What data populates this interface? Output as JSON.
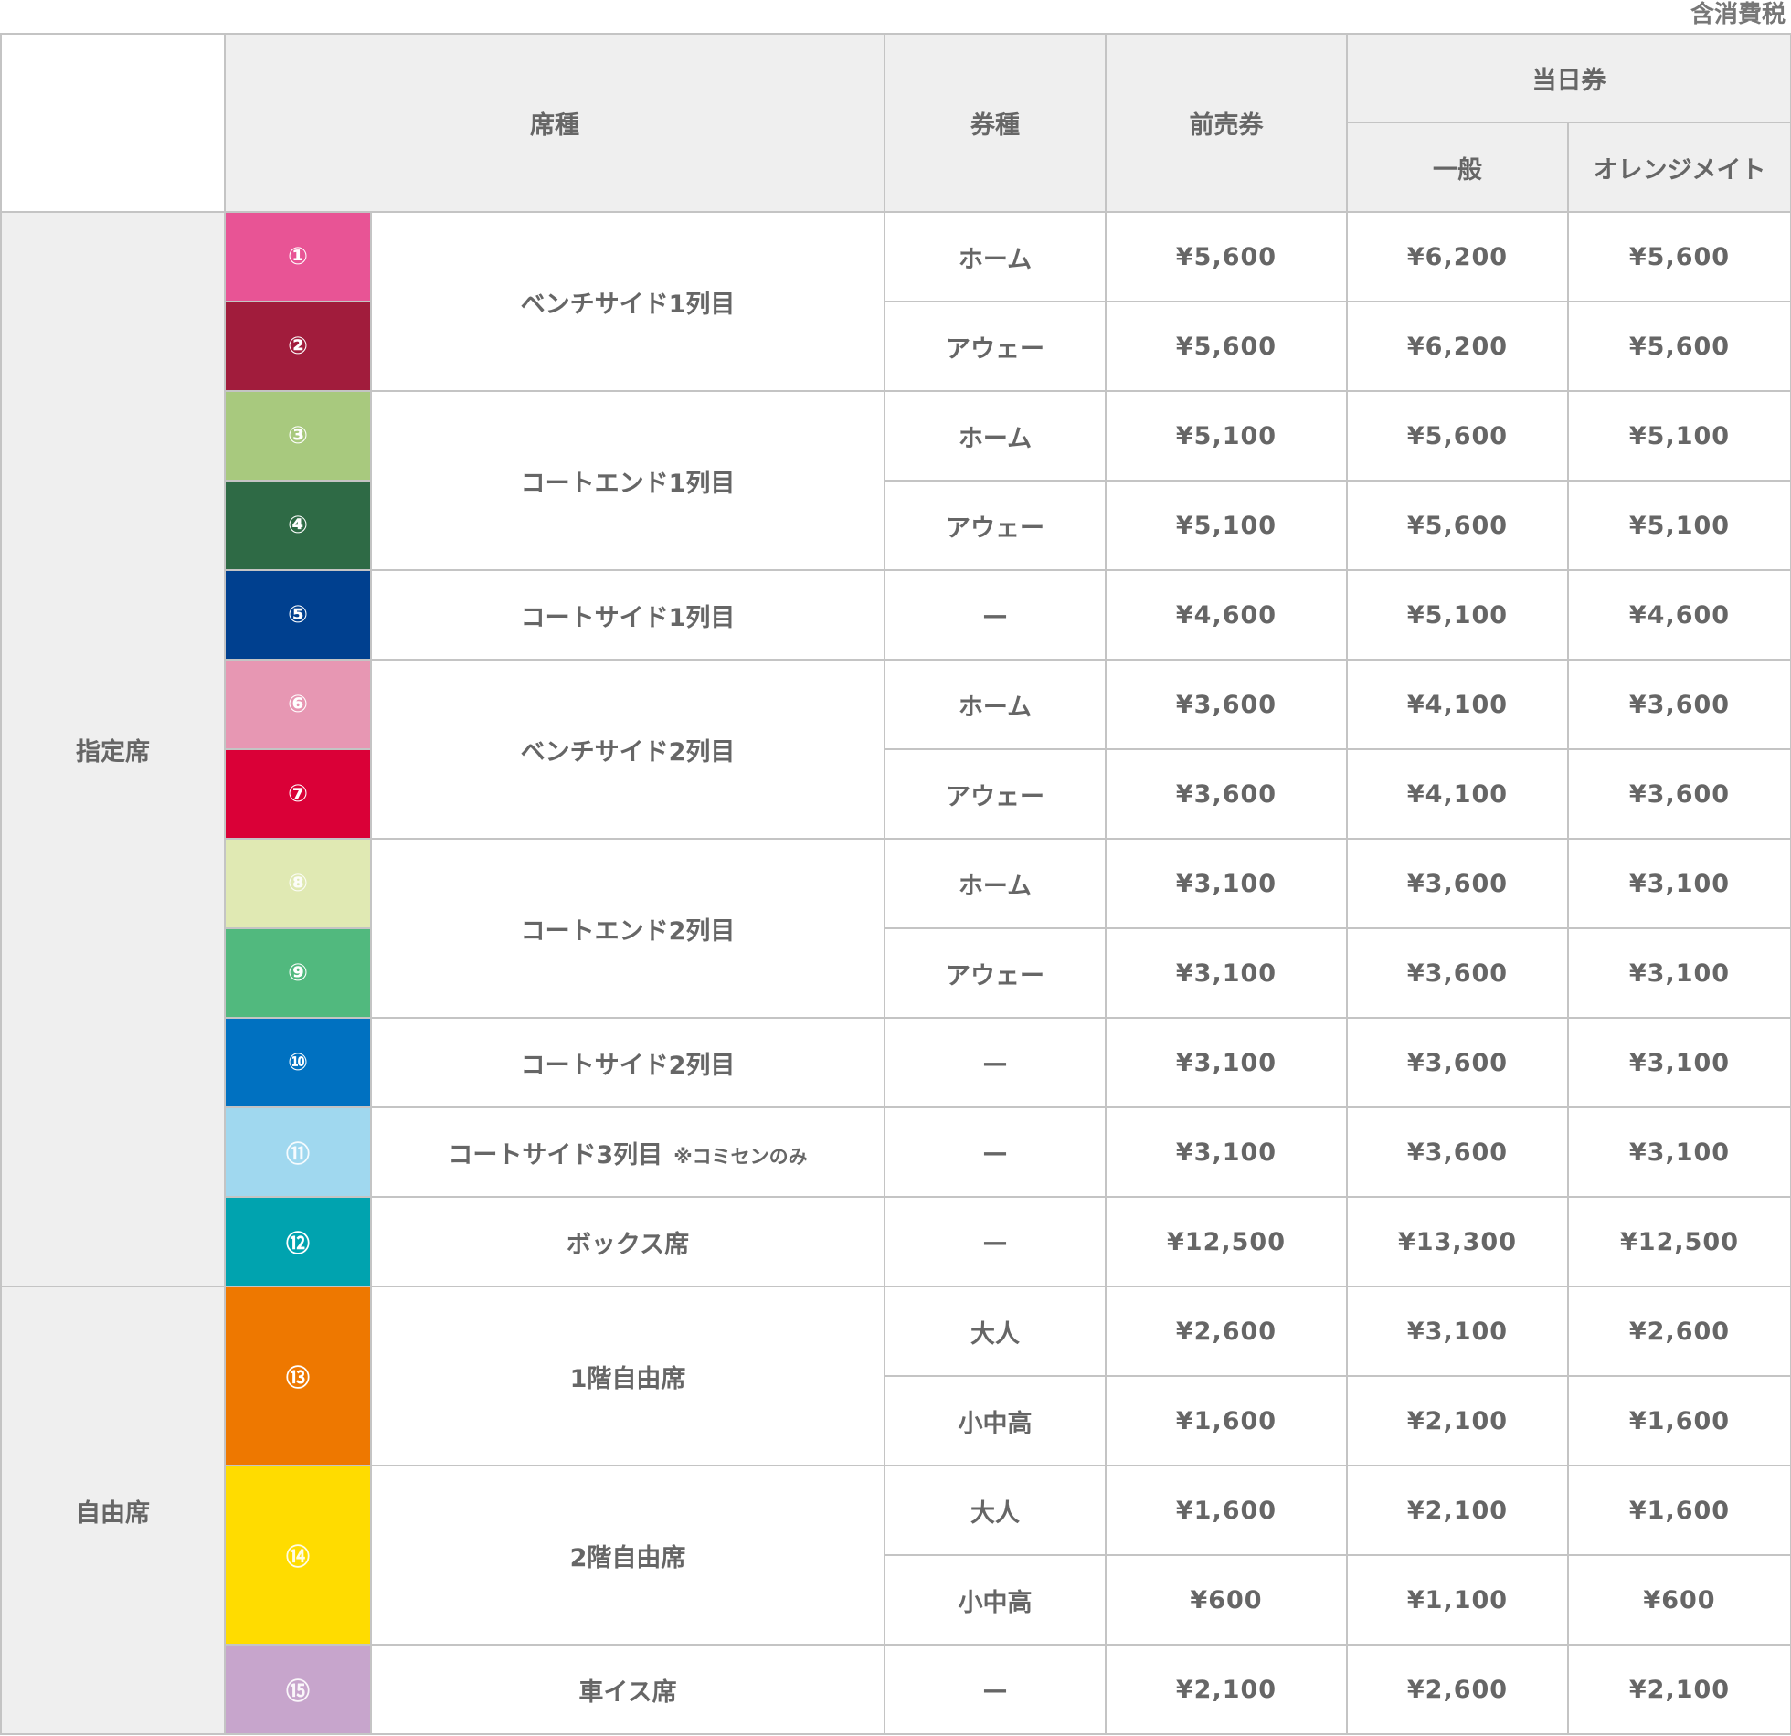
{
  "tax_note": "含消費税",
  "header": {
    "seat_type": "席種",
    "ticket_type": "券種",
    "advance": "前売券",
    "day_of": "当日券",
    "general": "一般",
    "orange_mate": "オレンジメイト"
  },
  "groups": [
    {
      "label": "指定席"
    },
    {
      "label": "自由席"
    }
  ],
  "seats": [
    {
      "num": "①",
      "color": "#e85495",
      "name": "ベンチサイド1列目",
      "note": ""
    },
    {
      "num": "②",
      "color": "#a11c3c",
      "name": "",
      "note": ""
    },
    {
      "num": "③",
      "color": "#a8c97e",
      "name": "コートエンド1列目",
      "note": ""
    },
    {
      "num": "④",
      "color": "#2e6a45",
      "name": "",
      "note": ""
    },
    {
      "num": "⑤",
      "color": "#00408f",
      "name": "コートサイド1列目",
      "note": ""
    },
    {
      "num": "⑥",
      "color": "#e797b3",
      "name": "ベンチサイド2列目",
      "note": ""
    },
    {
      "num": "⑦",
      "color": "#da0037",
      "name": "",
      "note": ""
    },
    {
      "num": "⑧",
      "color": "#e0e9b3",
      "name": "コートエンド2列目",
      "note": ""
    },
    {
      "num": "⑨",
      "color": "#51b97e",
      "name": "",
      "note": ""
    },
    {
      "num": "⑩",
      "color": "#0071c1",
      "name": "コートサイド2列目",
      "note": ""
    },
    {
      "num": "⑪",
      "color": "#a0d8ef",
      "name": "コートサイド3列目",
      "note": "※コミセンのみ"
    },
    {
      "num": "⑫",
      "color": "#00a3af",
      "name": "ボックス席",
      "note": ""
    },
    {
      "num": "⑬",
      "color": "#ee7800",
      "name": "1階自由席",
      "note": ""
    },
    {
      "num": "⑭",
      "color": "#ffdc00",
      "name": "2階自由席",
      "note": ""
    },
    {
      "num": "⑮",
      "color": "#c7a5cc",
      "name": "車イス席",
      "note": ""
    }
  ],
  "rows": [
    {
      "ticket": "ホーム",
      "advance": "¥5,600",
      "general": "¥6,200",
      "orange": "¥5,600"
    },
    {
      "ticket": "アウェー",
      "advance": "¥5,600",
      "general": "¥6,200",
      "orange": "¥5,600"
    },
    {
      "ticket": "ホーム",
      "advance": "¥5,100",
      "general": "¥5,600",
      "orange": "¥5,100"
    },
    {
      "ticket": "アウェー",
      "advance": "¥5,100",
      "general": "¥5,600",
      "orange": "¥5,100"
    },
    {
      "ticket": "—",
      "advance": "¥4,600",
      "general": "¥5,100",
      "orange": "¥4,600"
    },
    {
      "ticket": "ホーム",
      "advance": "¥3,600",
      "general": "¥4,100",
      "orange": "¥3,600"
    },
    {
      "ticket": "アウェー",
      "advance": "¥3,600",
      "general": "¥4,100",
      "orange": "¥3,600"
    },
    {
      "ticket": "ホーム",
      "advance": "¥3,100",
      "general": "¥3,600",
      "orange": "¥3,100"
    },
    {
      "ticket": "アウェー",
      "advance": "¥3,100",
      "general": "¥3,600",
      "orange": "¥3,100"
    },
    {
      "ticket": "—",
      "advance": "¥3,100",
      "general": "¥3,600",
      "orange": "¥3,100"
    },
    {
      "ticket": "—",
      "advance": "¥3,100",
      "general": "¥3,600",
      "orange": "¥3,100"
    },
    {
      "ticket": "—",
      "advance": "¥12,500",
      "general": "¥13,300",
      "orange": "¥12,500"
    },
    {
      "ticket": "大人",
      "advance": "¥2,600",
      "general": "¥3,100",
      "orange": "¥2,600"
    },
    {
      "ticket": "小中高",
      "advance": "¥1,600",
      "general": "¥2,100",
      "orange": "¥1,600"
    },
    {
      "ticket": "大人",
      "advance": "¥1,600",
      "general": "¥2,100",
      "orange": "¥1,600"
    },
    {
      "ticket": "小中高",
      "advance": "¥600",
      "general": "¥1,100",
      "orange": "¥600"
    },
    {
      "ticket": "—",
      "advance": "¥2,100",
      "general": "¥2,600",
      "orange": "¥2,100"
    }
  ]
}
